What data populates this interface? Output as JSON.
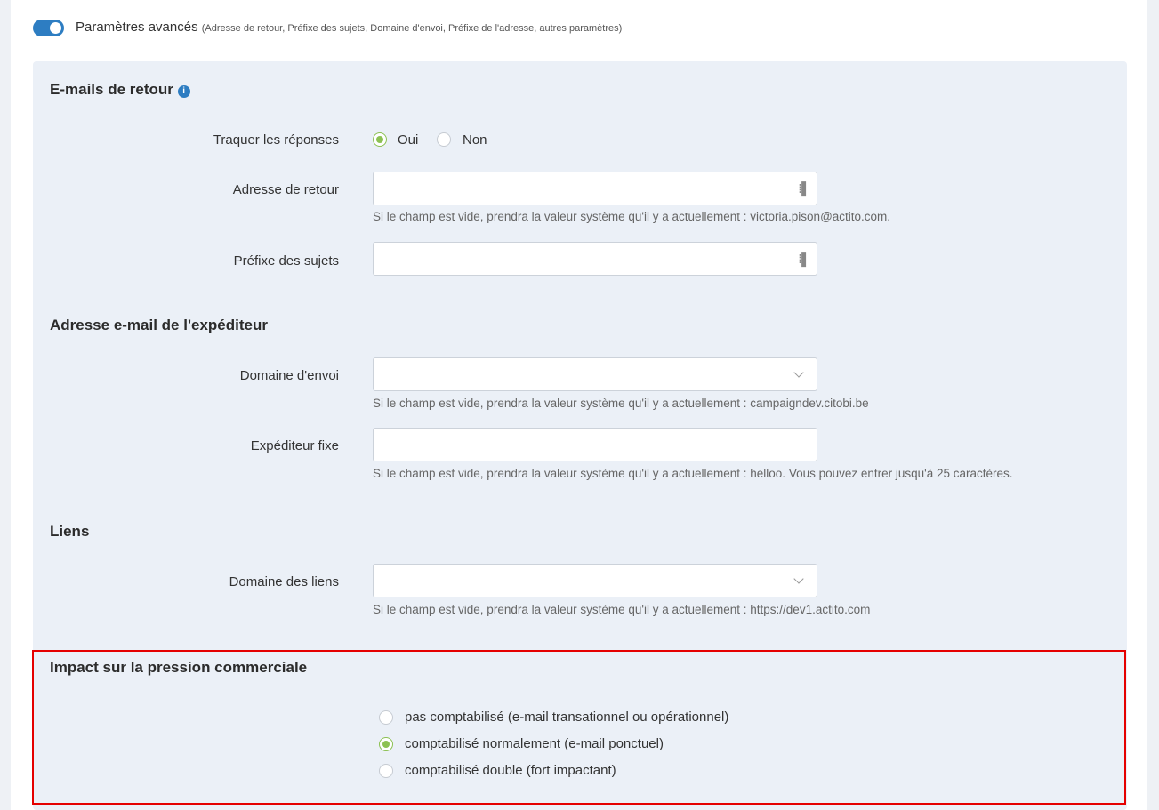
{
  "advanced": {
    "label": "Paramètres avancés",
    "sub": "(Adresse de retour, Préfixe des sujets, Domaine d'envoi, Préfixe de l'adresse, autres paramètres)",
    "enabled": true
  },
  "colors": {
    "accent": "#2d7dc2",
    "radio": "#8cc152",
    "highlight": "#e50000"
  },
  "return_emails": {
    "title": "E-mails de retour",
    "track_label": "Traquer les réponses",
    "yes": "Oui",
    "no": "Non",
    "track_value": "Oui",
    "return_address_label": "Adresse de retour",
    "return_address_value": "",
    "return_address_hint": "Si le champ est vide, prendra la valeur système qu'il y a actuellement : victoria.pison@actito.com.",
    "subject_prefix_label": "Préfixe des sujets",
    "subject_prefix_value": ""
  },
  "sender": {
    "title": "Adresse e-mail de l'expéditeur",
    "domain_label": "Domaine d'envoi",
    "domain_value": "",
    "domain_hint": "Si le champ est vide, prendra la valeur système qu'il y a actuellement : campaigndev.citobi.be",
    "fixed_label": "Expéditeur fixe",
    "fixed_value": "",
    "fixed_hint": "Si le champ est vide, prendra la valeur système qu'il y a actuellement : helloo. Vous pouvez entrer jusqu'à 25 caractères."
  },
  "links": {
    "title": "Liens",
    "domain_label": "Domaine des liens",
    "domain_value": "",
    "domain_hint": "Si le champ est vide, prendra la valeur système qu'il y a actuellement : https://dev1.actito.com"
  },
  "pressure": {
    "title": "Impact sur la pression commerciale",
    "options": [
      "pas comptabilisé (e-mail transationnel ou opérationnel)",
      "comptabilisé normalement (e-mail ponctuel)",
      "comptabilisé double (fort impactant)"
    ],
    "selected": "comptabilisé normalement (e-mail ponctuel)"
  }
}
